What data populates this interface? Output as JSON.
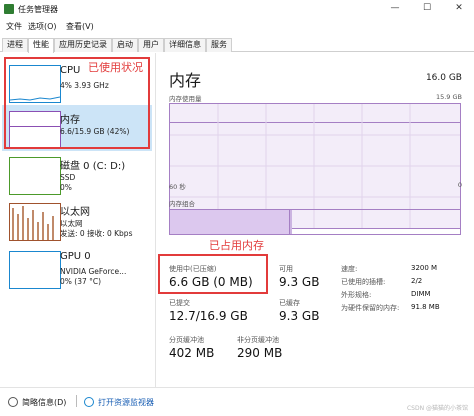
{
  "window": {
    "title": "任务管理器",
    "min_glyph": "—",
    "max_glyph": "☐",
    "close_glyph": "✕"
  },
  "menu": [
    "文件",
    "选项(O)",
    "查看(V)"
  ],
  "tabs": [
    {
      "label": "进程",
      "active": false
    },
    {
      "label": "性能",
      "active": true
    },
    {
      "label": "应用历史记录",
      "active": false
    },
    {
      "label": "启动",
      "active": false
    },
    {
      "label": "用户",
      "active": false
    },
    {
      "label": "详细信息",
      "active": false
    },
    {
      "label": "服务",
      "active": false
    }
  ],
  "resources": [
    {
      "name": "CPU",
      "detail1": "4% 3.93 GHz",
      "detail2": "",
      "color": "#1a87cf",
      "selected": false
    },
    {
      "name": "内存",
      "detail1": "6.6/15.9 GB (42%)",
      "detail2": "",
      "color": "#8b4fb3",
      "selected": true
    },
    {
      "name": "磁盘 0 (C: D:)",
      "detail1": "SSD",
      "detail2": "0%",
      "color": "#4c9a2a",
      "selected": false
    },
    {
      "name": "以太网",
      "detail1": "以太网",
      "detail2": "发送: 0 接收: 0 Kbps",
      "color": "#a0522d",
      "selected": false
    },
    {
      "name": "GPU 0",
      "detail1": "NVIDIA GeForce...",
      "detail2": "0% (37 °C)",
      "color": "#1a87cf",
      "selected": false
    }
  ],
  "memory": {
    "title": "内存",
    "total": "16.0 GB",
    "usage_label": "内存使用量",
    "usage_max": "15.9 GB",
    "time_left": "60 秒",
    "time_right": "0",
    "composition_label": "内存组合",
    "stats": {
      "in_use_label": "使用中(已压缩)",
      "in_use_value": "6.6 GB (0 MB)",
      "available_label": "可用",
      "available_value": "9.3 GB",
      "committed_label": "已提交",
      "committed_value": "12.7/16.9 GB",
      "cached_label": "已缓存",
      "cached_value": "9.3 GB",
      "paged_label": "分页缓冲池",
      "paged_value": "402 MB",
      "nonpaged_label": "非分页缓冲池",
      "nonpaged_value": "290 MB"
    },
    "specs": [
      {
        "label": "速度:",
        "value": "3200 M"
      },
      {
        "label": "已使用的插槽:",
        "value": "2/2"
      },
      {
        "label": "外形规格:",
        "value": "DIMM"
      },
      {
        "label": "为硬件保留的内存:",
        "value": "91.8 MB"
      }
    ]
  },
  "annotations": {
    "left_box_text": "已使用状况",
    "right_box_text": "已占用内存",
    "color": "#e23b3b"
  },
  "footer": {
    "brief_label": "简略信息(D)",
    "monitor_label": "打开资源监视器",
    "watermark": "CSDN @猫猫的小茶馆"
  }
}
